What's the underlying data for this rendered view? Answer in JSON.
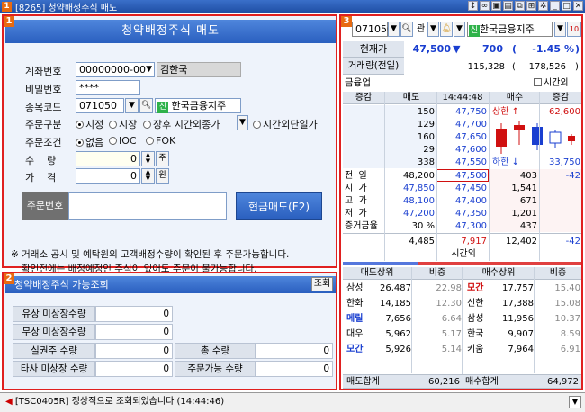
{
  "window": {
    "num": "1",
    "title": "[8265] 청약배정주식 매도"
  },
  "panel1": {
    "num": "1",
    "title": "청약배정주식 매도",
    "account_label": "계좌번호",
    "account_value": "00000000-00",
    "account_name": "김한국",
    "password_label": "비밀번호",
    "password_value": "****",
    "code_label": "종목코드",
    "code_value": "071050",
    "code_name": "한국금융지주",
    "order_type_label": "주문구분",
    "order_type_options": [
      "지정",
      "시장",
      "장후 시간외종가",
      "시간외단일가"
    ],
    "order_cond_label": "주문조건",
    "order_cond_options": [
      "없음",
      "IOC",
      "FOK"
    ],
    "qty_label": "수    량",
    "qty_value": "0",
    "qty_unit": "주",
    "price_label": "가    격",
    "price_value": "0",
    "price_unit": "원",
    "order_no_label": "주문번호",
    "sell_button": "현금매도(F2)",
    "notice_line1": "※ 거래소 공시 및 예탁원의 고객배정수량이 확인된 후 주문가능합니다.",
    "notice_line2": "확인전에는 배정예정인 주식이 있어도 주문이 불가능합니다."
  },
  "panel2": {
    "num": "2",
    "title": "청약배정주식 가능조회",
    "query_button": "조회",
    "rows": [
      {
        "label": "유상 미상장수량",
        "value": "0"
      },
      {
        "label": "무상 미상장수량",
        "value": "0"
      },
      {
        "label": "실권주 수량",
        "value": "0"
      },
      {
        "label": "타사 미상장 수량",
        "value": "0"
      }
    ],
    "total_label": "총  수량",
    "total_value": "0",
    "orderable_label": "주문가능 수량",
    "orderable_value": "0"
  },
  "panel3": {
    "num": "3",
    "code": "071050",
    "tab_label": "관",
    "name": "한국금융지주",
    "price_label": "현재가",
    "price": "47,500",
    "change": "700",
    "change_pct": "-1.45",
    "pct_unit": "%",
    "volume_label": "거래량(전일)",
    "volume": "115,328",
    "prev_volume": "178,526",
    "sector": "금융업",
    "after_hours_label": "시간외",
    "hdr_change": "증감",
    "hdr_ask": "매도",
    "time": "14:44:48",
    "hdr_bid": "매수",
    "upper_label": "상한",
    "upper_price": "62,600",
    "lower_label": "하한",
    "lower_price": "33,750",
    "asks": [
      {
        "qty": "150",
        "price": "47,750"
      },
      {
        "qty": "129",
        "price": "47,700"
      },
      {
        "qty": "160",
        "price": "47,650"
      },
      {
        "qty": "29",
        "price": "47,600"
      },
      {
        "qty": "338",
        "price": "47,550"
      }
    ],
    "bids": [
      {
        "price": "47,500",
        "qty": "403",
        "chg": "-42"
      },
      {
        "price": "47,450",
        "qty": "1,541",
        "chg": ""
      },
      {
        "price": "47,400",
        "qty": "671",
        "chg": ""
      },
      {
        "price": "47,350",
        "qty": "1,201",
        "chg": ""
      },
      {
        "price": "47,300",
        "qty": "437",
        "chg": ""
      }
    ],
    "info": [
      {
        "label": "전  일",
        "value": "48,200"
      },
      {
        "label": "시  가",
        "value": "47,850"
      },
      {
        "label": "고  가",
        "value": "48,100"
      },
      {
        "label": "저  가",
        "value": "47,200"
      },
      {
        "label": "증거금율",
        "value": "30 %"
      }
    ],
    "total_ask": "4,485",
    "total_diff": "7,917",
    "total_bid": "12,402",
    "total_chg": "-42",
    "after_label": "시간외",
    "broker_hdr_sell": "매도상위",
    "broker_hdr_ratio": "비중",
    "broker_hdr_buy": "매수상위",
    "brokers": [
      {
        "s_name": "삼성",
        "s_qty": "26,487",
        "s_pct": "22.98",
        "b_name": "모간",
        "b_qty": "17,757",
        "b_pct": "15.40"
      },
      {
        "s_name": "한화",
        "s_qty": "14,185",
        "s_pct": "12.30",
        "b_name": "신한",
        "b_qty": "17,388",
        "b_pct": "15.08"
      },
      {
        "s_name": "메릴",
        "s_qty": "7,656",
        "s_pct": "6.64",
        "b_name": "삼성",
        "b_qty": "11,956",
        "b_pct": "10.37"
      },
      {
        "s_name": "대우",
        "s_qty": "5,962",
        "s_pct": "5.17",
        "b_name": "한국",
        "b_qty": "9,907",
        "b_pct": "8.59"
      },
      {
        "s_name": "모간",
        "s_qty": "5,926",
        "s_pct": "5.14",
        "b_name": "키움",
        "b_qty": "7,964",
        "b_pct": "6.91"
      }
    ],
    "sell_total_label": "매도합계",
    "sell_total": "60,216",
    "buy_total_label": "매수합계",
    "buy_total": "64,972"
  },
  "status": {
    "message": "[TSC0405R] 정상적으로 조회되었습니다 (14:44:46)"
  },
  "colors": {
    "accent": "#2a5fbf",
    "frame": "#e02020",
    "up": "#d01010",
    "down": "#1a3fd0"
  }
}
